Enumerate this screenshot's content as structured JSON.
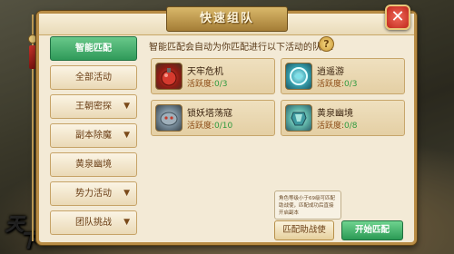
{
  "window": {
    "title": "快速组队"
  },
  "sidebar": {
    "items": [
      {
        "label": "智能匹配",
        "active": true,
        "has_chevron": false
      },
      {
        "label": "全部活动",
        "active": false,
        "has_chevron": false
      },
      {
        "label": "王朝密探",
        "active": false,
        "has_chevron": true
      },
      {
        "label": "副本除魔",
        "active": false,
        "has_chevron": true
      },
      {
        "label": "黄泉幽境",
        "active": false,
        "has_chevron": false
      },
      {
        "label": "势力活动",
        "active": false,
        "has_chevron": true
      },
      {
        "label": "团队挑战",
        "active": false,
        "has_chevron": true
      }
    ],
    "chevron_glyph": "▼"
  },
  "main": {
    "header": "智能匹配会自动为你匹配进行以下活动的队伍:",
    "help_glyph": "?",
    "activity_label": "活跃度:",
    "cards": [
      {
        "name": "天牢危机",
        "activity": "0/3",
        "icon": "red-bomb-icon"
      },
      {
        "name": "逍遥游",
        "activity": "0/3",
        "icon": "blue-portal-icon"
      },
      {
        "name": "锁妖塔荡寇",
        "activity": "0/10",
        "icon": "stone-demon-icon"
      },
      {
        "name": "黄泉幽境",
        "activity": "0/8",
        "icon": "jade-armor-icon"
      }
    ]
  },
  "footer": {
    "tooltip": "角色等级小于69级可匹配助战使，匹配成功后直接开启副本",
    "assist_button": "匹配助战使",
    "start_button": "开始匹配"
  },
  "logo_text": "天下",
  "colors": {
    "accent_green": "#2f9a59",
    "activity_value": "#2f9a3e",
    "frame_gold": "#b88c45",
    "close_red": "#c0281c"
  }
}
